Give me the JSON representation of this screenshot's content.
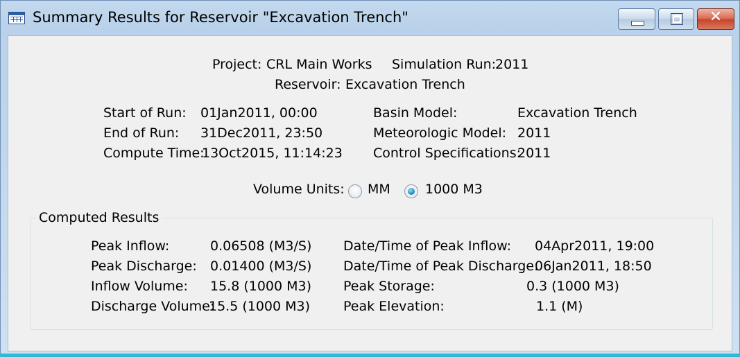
{
  "window": {
    "title": "Summary Results for Reservoir \"Excavation Trench\"",
    "close_glyph": "✕"
  },
  "header": {
    "project_label": "Project:",
    "project_value": "CRL Main Works",
    "simulation_label": "Simulation Run:",
    "simulation_value": "2011",
    "reservoir_label": "Reservoir:",
    "reservoir_value": "Excavation Trench"
  },
  "run_info": {
    "start_label": "Start of Run:",
    "start_value": "01Jan2011, 00:00",
    "end_label": "End of Run:",
    "end_value": "31Dec2011, 23:50",
    "compute_label": "Compute Time:",
    "compute_value": "13Oct2015, 11:14:23",
    "basin_label": "Basin Model:",
    "basin_value": "Excavation Trench",
    "met_label": "Meteorologic Model:",
    "met_value": "2011",
    "control_label": "Control Specifications:",
    "control_value": "2011"
  },
  "volume_units": {
    "label": "Volume Units:",
    "options": [
      {
        "label": "MM",
        "selected": false
      },
      {
        "label": "1000 M3",
        "selected": true
      }
    ]
  },
  "computed_results": {
    "title": "Computed Results",
    "left": [
      {
        "label": "Peak Inflow:",
        "value": "0.06508 (M3/S)"
      },
      {
        "label": "Peak Discharge:",
        "value": "0.01400 (M3/S)"
      },
      {
        "label": "Inflow Volume:",
        "value": "15.8 (1000 M3)"
      },
      {
        "label": "Discharge Volume:",
        "value": "15.5 (1000 M3)"
      }
    ],
    "right": [
      {
        "label": "Date/Time of Peak Inflow:",
        "value": "04Apr2011, 19:00"
      },
      {
        "label": "Date/Time of Peak Discharge:",
        "value": "06Jan2011, 18:50"
      },
      {
        "label": "Peak Storage:",
        "value": "0.3 (1000 M3)"
      },
      {
        "label": "Peak Elevation:",
        "value": "1.1 (M)"
      }
    ]
  },
  "colors": {
    "title_bar": "#b9d1ea",
    "client_bg": "#f0f0f0",
    "close_button": "#c4422a",
    "accent_strip": "#2fb9d9"
  }
}
